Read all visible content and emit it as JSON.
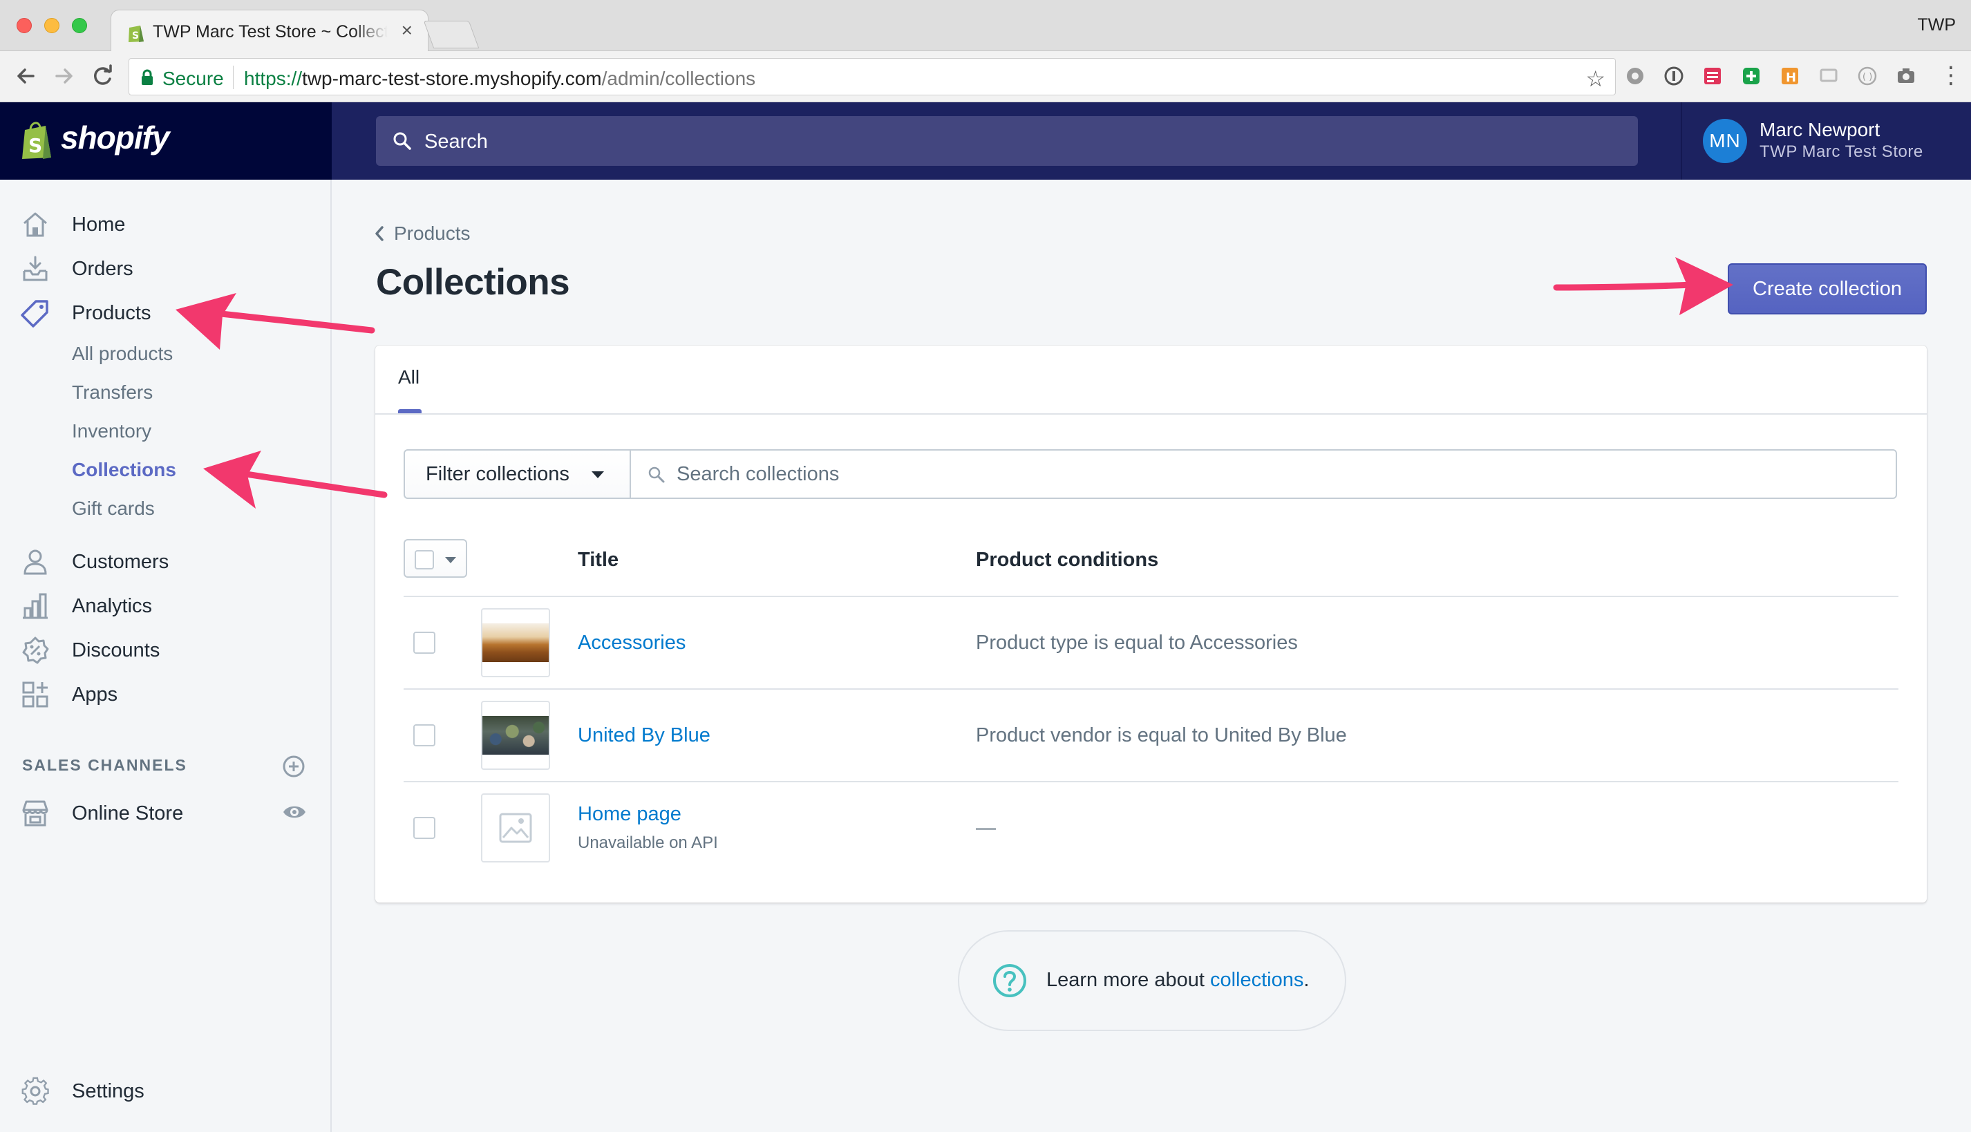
{
  "browser": {
    "tab_title": "TWP Marc Test Store ~ Collections",
    "tab_close": "×",
    "profile": "TWP",
    "secure_label": "Secure",
    "url_scheme": "https://",
    "url_host": "twp-marc-test-store.myshopify.com",
    "url_path": "/admin/collections"
  },
  "topbar": {
    "logo_text": "shopify",
    "search_placeholder": "Search",
    "user_initials": "MN",
    "user_name": "Marc Newport",
    "store_name": "TWP Marc Test Store"
  },
  "sidebar": {
    "items": [
      {
        "label": "Home",
        "icon": "home-icon"
      },
      {
        "label": "Orders",
        "icon": "orders-icon"
      },
      {
        "label": "Products",
        "icon": "tag-icon"
      },
      {
        "label": "Customers",
        "icon": "customer-icon"
      },
      {
        "label": "Analytics",
        "icon": "analytics-icon"
      },
      {
        "label": "Discounts",
        "icon": "discount-icon"
      },
      {
        "label": "Apps",
        "icon": "apps-icon"
      }
    ],
    "product_subitems": [
      "All products",
      "Transfers",
      "Inventory",
      "Collections",
      "Gift cards"
    ],
    "active_subitem": "Collections",
    "channels_heading": "SALES CHANNELS",
    "online_store": "Online Store",
    "settings": "Settings"
  },
  "main": {
    "breadcrumb": "Products",
    "title": "Collections",
    "create_button": "Create collection",
    "tabs": [
      "All"
    ],
    "filter_label": "Filter collections",
    "search_placeholder": "Search collections",
    "columns": [
      "Title",
      "Product conditions"
    ],
    "rows": [
      {
        "title": "Accessories",
        "subtitle": "",
        "condition": "Product type is equal to Accessories",
        "thumb": "accessories-thumbnail"
      },
      {
        "title": "United By Blue",
        "subtitle": "",
        "condition": "Product vendor is equal to United By Blue",
        "thumb": "united-by-blue-thumbnail"
      },
      {
        "title": "Home page",
        "subtitle": "Unavailable on API",
        "condition": "—",
        "thumb": "image-placeholder-icon"
      }
    ],
    "help_prefix": "Learn more about ",
    "help_link": "collections",
    "help_suffix": "."
  },
  "colors": {
    "topbar": "#1c2260",
    "topbar_left": "#000639",
    "primary": "#5c6ac4",
    "link": "#007ace",
    "annotation_arrow": "#f2386d"
  }
}
